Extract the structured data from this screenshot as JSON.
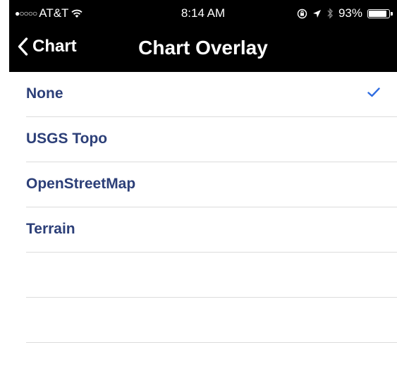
{
  "status_bar": {
    "signal": "●○○○○",
    "carrier": "AT&T",
    "time": "8:14 AM",
    "battery": "93%",
    "battery_level": 0.93
  },
  "nav": {
    "back_label": "Chart",
    "title": "Chart Overlay"
  },
  "options": [
    {
      "label": "None",
      "selected": true
    },
    {
      "label": "USGS Topo",
      "selected": false
    },
    {
      "label": "OpenStreetMap",
      "selected": false
    },
    {
      "label": "Terrain",
      "selected": false
    },
    {
      "label": "",
      "selected": false
    },
    {
      "label": "",
      "selected": false
    }
  ],
  "colors": {
    "accent": "#2f6de1",
    "label": "#2c3f78",
    "bar": "#000000"
  }
}
